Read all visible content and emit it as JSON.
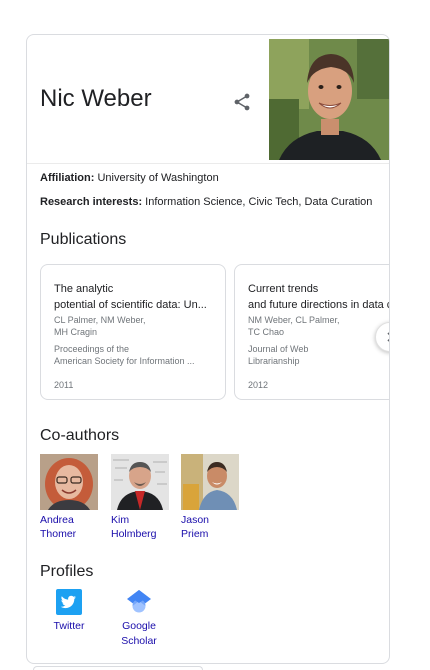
{
  "person": {
    "name": "Nic Weber"
  },
  "facts": [
    {
      "label": "Affiliation:",
      "value": "University of Washington"
    },
    {
      "label": "Research interests:",
      "value": "Information Science, Civic Tech, Data Curation"
    }
  ],
  "publications": {
    "title": "Publications",
    "items": [
      {
        "title_lines": [
          "The analytic",
          "potential of scientific data: Un..."
        ],
        "author_lines": [
          "CL Palmer, NM Weber,",
          "MH Cragin"
        ],
        "journal_lines": [
          "Proceedings of the",
          "American Society for Information ..."
        ],
        "year": "2011"
      },
      {
        "title_lines": [
          "Current trends",
          "and future directions in data cu..."
        ],
        "author_lines": [
          "NM Weber, CL Palmer,",
          "TC Chao"
        ],
        "journal_lines": [
          "Journal of Web",
          "Librarianship"
        ],
        "year": "2012"
      }
    ]
  },
  "coauthors": {
    "title": "Co-authors",
    "items": [
      {
        "name_lines": [
          "Andrea",
          "Thomer"
        ]
      },
      {
        "name_lines": [
          "Kim",
          "Holmberg"
        ]
      },
      {
        "name_lines": [
          "Jason",
          "Priem"
        ]
      }
    ]
  },
  "profiles": {
    "title": "Profiles",
    "items": [
      {
        "name_lines": [
          "Twitter"
        ],
        "icon": "twitter-icon",
        "color": "#1da1f2"
      },
      {
        "name_lines": [
          "Google",
          "Scholar"
        ],
        "icon": "google-scholar-icon",
        "color": "#4285f4"
      }
    ]
  },
  "colors": {
    "link": "#1a0dab",
    "secondary_text": "#70757a",
    "border": "#dadce0"
  }
}
